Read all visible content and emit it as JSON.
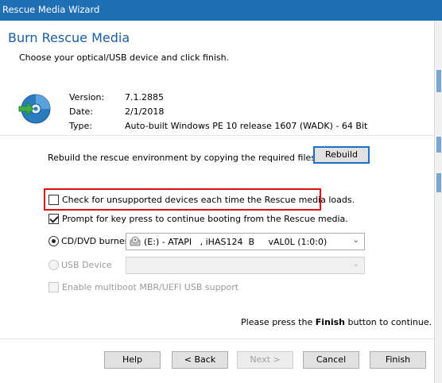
{
  "window": {
    "title": "Rescue Media Wizard"
  },
  "header": {
    "title": "Burn Rescue Media",
    "subtitle": "Choose your optical/USB device and click finish."
  },
  "info": {
    "version_label": "Version:",
    "version_value": "7.1.2885",
    "date_label": "Date:",
    "date_value": "2/1/2018",
    "type_label": "Type:",
    "type_value": "Auto-built Windows PE 10 release 1607 (WADK) - 64 Bit"
  },
  "rebuild": {
    "text": "Rebuild the rescue environment by copying the required files",
    "button": "Rebuild"
  },
  "options": {
    "unsupported_devices": {
      "label": "Check for unsupported devices each time the Rescue media loads.",
      "checked": false
    },
    "prompt_key": {
      "label": "Prompt for key press to continue booting from the Rescue media.",
      "checked": true
    },
    "cd_dvd": {
      "label": "CD/DVD burner",
      "selected": true,
      "value": "(E:) - ATAPI   , iHAS124  B     vAL0L (1:0:0)"
    },
    "usb": {
      "label": "USB Device",
      "selected": false,
      "enabled": false,
      "value": ""
    },
    "multiboot": {
      "label": "Enable multiboot MBR/UEFI USB support",
      "checked": false,
      "enabled": false
    }
  },
  "hint": {
    "prefix": "Please press the ",
    "emphasis": "Finish",
    "suffix": " button to continue."
  },
  "buttons": {
    "help": "Help",
    "back": "< Back",
    "next": "Next >",
    "cancel": "Cancel",
    "finish": "Finish"
  },
  "colors": {
    "title_bar": "#1f6fb5",
    "heading": "#1b5ea8",
    "highlight": "#e01010",
    "accent": "#1a6fc9"
  },
  "icons": {
    "main": "cd-with-arrow-icon",
    "drive": "optical-drive-icon",
    "dropdown": "chevron-down-icon"
  }
}
